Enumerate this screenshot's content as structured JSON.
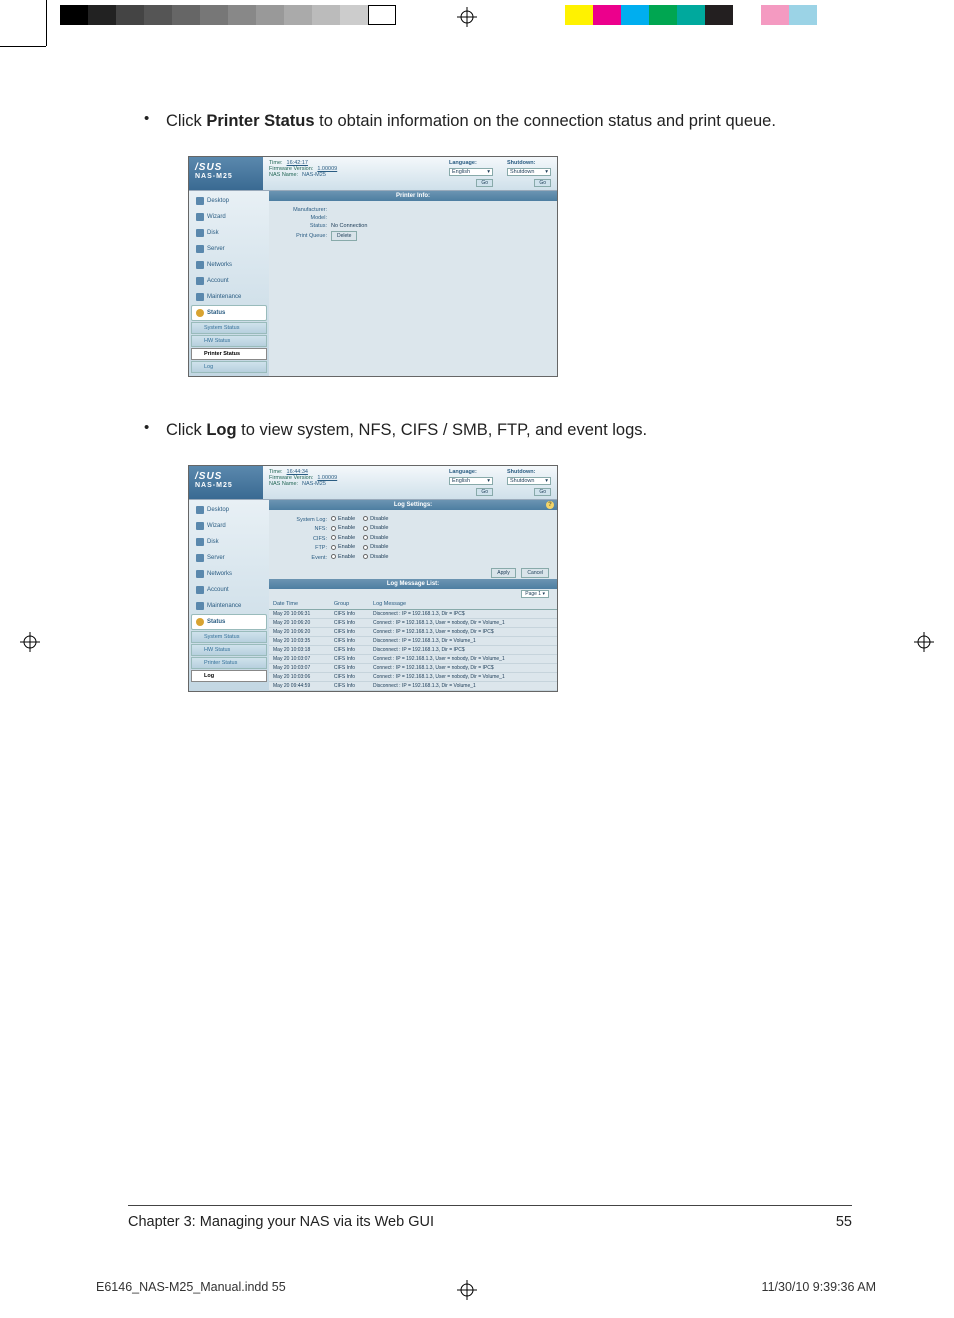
{
  "bullets": {
    "b1_prefix": "Click ",
    "b1_bold": "Printer Status",
    "b1_rest": " to obtain information on the connection status and print queue.",
    "b2_prefix": "Click ",
    "b2_bold": "Log",
    "b2_rest": " to view system, NFS, CIFS / SMB, FTP, and event logs."
  },
  "shared_header": {
    "product": "NAS-M25",
    "time_label": "Time:",
    "fw_label": "Firmware Version:",
    "fw_value": "1.00009",
    "nas_label": "NAS Name:",
    "nas_value": "NAS-M25",
    "lang_label": "Language:",
    "lang_value": "English",
    "shutdown_label": "Shutdown:",
    "shutdown_value": "Shutdown",
    "go": "Go"
  },
  "nav": {
    "desktop": "Desktop",
    "wizard": "Wizard",
    "disk": "Disk",
    "server": "Server",
    "networks": "Networks",
    "account": "Account",
    "maintenance": "Maintenance",
    "status": "Status",
    "system_status": "System Status",
    "hw_status": "HW Status",
    "printer_status": "Printer Status",
    "log": "Log"
  },
  "ss1": {
    "time_value": "16:42:17",
    "panel_title": "Printer Info:",
    "rows": {
      "manufacturer": "Manufacturer:",
      "model": "Model:",
      "status_lbl": "Status:",
      "status_val": "No Connection",
      "queue_lbl": "Print Queue:",
      "queue_btn": "Delete"
    }
  },
  "ss2": {
    "time_value": "16:44:34",
    "panel1_title": "Log Settings:",
    "rows": {
      "system": "System Log:",
      "nfs": "NFS:",
      "cifs": "CIFS:",
      "ftp": "FTP:",
      "event": "Event:"
    },
    "enable": "Enable",
    "disable": "Disable",
    "apply": "Apply",
    "cancel": "Cancel",
    "panel2_title": "Log Message List:",
    "page_label": "Page 1",
    "cols": {
      "date": "Date Time",
      "group": "Group",
      "msg": "Log Message"
    },
    "entries": [
      {
        "dt": "May 20 10:06:31",
        "grp": "CIFS Info",
        "msg": "Disconnect : IP = 192.168.1.3, Dir = IPC$"
      },
      {
        "dt": "May 20 10:06:20",
        "grp": "CIFS Info",
        "msg": "Connect : IP = 192.168.1.3, User = nobody, Dir = Volume_1"
      },
      {
        "dt": "May 20 10:06:20",
        "grp": "CIFS Info",
        "msg": "Connect : IP = 192.168.1.3, User = nobody, Dir = IPC$"
      },
      {
        "dt": "May 20 10:03:35",
        "grp": "CIFS Info",
        "msg": "Disconnect : IP = 192.168.1.3, Dir = Volume_1"
      },
      {
        "dt": "May 20 10:03:18",
        "grp": "CIFS Info",
        "msg": "Disconnect : IP = 192.168.1.3, Dir = IPC$"
      },
      {
        "dt": "May 20 10:03:07",
        "grp": "CIFS Info",
        "msg": "Connect : IP = 192.168.1.3, User = nobody, Dir = Volume_1"
      },
      {
        "dt": "May 20 10:03:07",
        "grp": "CIFS Info",
        "msg": "Connect : IP = 192.168.1.3, User = nobody, Dir = IPC$"
      },
      {
        "dt": "May 20 10:03:06",
        "grp": "CIFS Info",
        "msg": "Connect : IP = 192.168.1.3, User = nobody, Dir = Volume_1"
      },
      {
        "dt": "May 20 09:44:59",
        "grp": "CIFS Info",
        "msg": "Disconnect : IP = 192.168.1.3, Dir = Volume_1"
      }
    ]
  },
  "footer": {
    "chapter": "Chapter 3: Managing your NAS via its Web GUI",
    "page": "55"
  },
  "slug": {
    "file": "E6146_NAS-M25_Manual.indd   55",
    "stamp": "11/30/10   9:39:36 AM"
  },
  "calib_left": [
    "#000",
    "#222",
    "#444",
    "#555",
    "#666",
    "#777",
    "#888",
    "#999",
    "#aaa",
    "#bbb",
    "#ccc",
    "#fff"
  ],
  "calib_right": [
    "#fff200",
    "#ec008c",
    "#00aeef",
    "#00a651",
    "#00a99d",
    "#231f20",
    "#fff",
    "#f49ac1",
    "#9bd3e6",
    "#fff"
  ]
}
